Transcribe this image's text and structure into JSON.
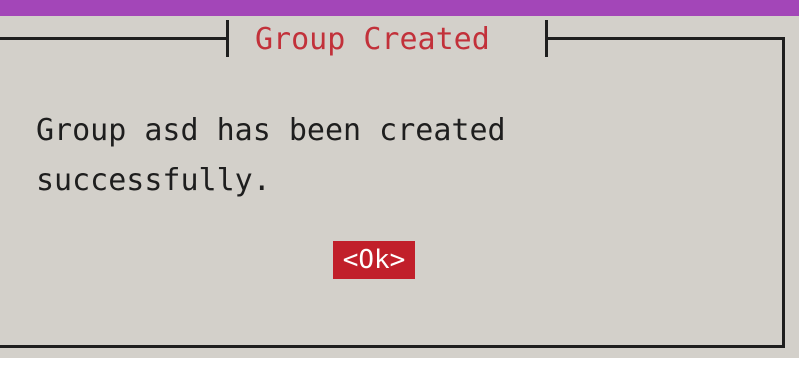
{
  "dialog": {
    "title": "Group Created",
    "message_line1": "Group asd has been created",
    "message_line2": "successfully.",
    "ok_label": "<Ok>"
  },
  "colors": {
    "top_bar": "#a346b8",
    "dialog_bg": "#d3d0ca",
    "title_text": "#c2313a",
    "button_bg": "#c11f2a",
    "frame": "#1e1e1e"
  }
}
